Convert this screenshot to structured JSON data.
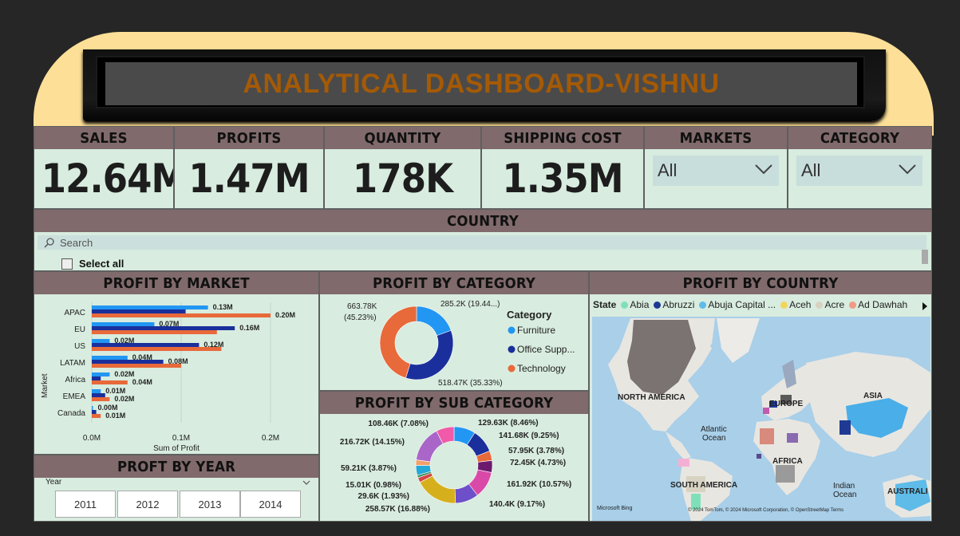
{
  "title": "ANALYTICAL DASHBOARD-VISHNU",
  "kpis": [
    {
      "label": "SALES",
      "value": "12.64M"
    },
    {
      "label": "PROFITS",
      "value": "1.47M"
    },
    {
      "label": "QUANTITY",
      "value": "178K"
    },
    {
      "label": "SHIPPING COST",
      "value": "1.35M"
    }
  ],
  "filters": {
    "markets": {
      "label": "MARKETS",
      "value": "All"
    },
    "category": {
      "label": "CATEGORY",
      "value": "All"
    }
  },
  "country_slicer": {
    "label": "COUNTRY",
    "search_placeholder": "Search",
    "select_all": "Select all"
  },
  "profit_by_market": {
    "title": "PROFIT BY MARKET",
    "ylabel": "Market",
    "xlabel": "Sum of Profit",
    "ticks": [
      "0.0M",
      "0.1M",
      "0.2M"
    ]
  },
  "profit_by_category": {
    "title": "PROFIT BY CATEGORY",
    "legend_title": "Category",
    "labels": [
      "663.78K",
      "(45.23%)",
      "285.2K (19.44...)",
      "518.47K (35.33%)"
    ]
  },
  "profit_by_sub_category": {
    "title": "PROFIT BY SUB CATEGORY"
  },
  "profit_by_year": {
    "title": "PROFT BY YEAR",
    "field": "Year",
    "years": [
      "2011",
      "2012",
      "2013",
      "2014"
    ]
  },
  "profit_by_country": {
    "title": "PROFIT BY COUNTRY",
    "legend_title": "State",
    "legend": [
      {
        "name": "Abia",
        "color": "#7fe0b8"
      },
      {
        "name": "Abruzzi",
        "color": "#1f3a93"
      },
      {
        "name": "Abuja Capital ...",
        "color": "#5fbbe8"
      },
      {
        "name": "Aceh",
        "color": "#f2d65a"
      },
      {
        "name": "Acre",
        "color": "#d8d2c2"
      },
      {
        "name": "Ad Dawhah",
        "color": "#f09a86"
      }
    ],
    "map_labels": [
      "NORTH AMERICA",
      "EUROPE",
      "ASIA",
      "Atlantic",
      "Ocean",
      "AFRICA",
      "SOUTH AMERICA",
      "Indian",
      "Ocean",
      "AUSTRALI"
    ],
    "attribution": "© 2024 TomTom, © 2024 Microsoft Corporation, © OpenStreetMap  Terms",
    "bing": "Microsoft Bing"
  },
  "chart_data": [
    {
      "type": "bar",
      "title": "PROFIT BY MARKET",
      "categories": [
        "APAC",
        "EU",
        "US",
        "LATAM",
        "Africa",
        "EMEA",
        "Canada"
      ],
      "xlabel": "Sum of Profit",
      "ylabel": "Market",
      "xlim": [
        0,
        0.24
      ],
      "series": [
        {
          "color": "#2196f3",
          "values": [
            0.13,
            0.07,
            0.02,
            0.04,
            0.02,
            0.01,
            0.0
          ],
          "labels": [
            "0.13M",
            "0.07M",
            "0.02M",
            "0.04M",
            "0.02M",
            "0.01M",
            "0.00M"
          ]
        },
        {
          "color": "#1a2f9b",
          "values": [
            0.105,
            0.16,
            0.12,
            0.08,
            0.01,
            0.015,
            0.005
          ],
          "labels": [
            "",
            "0.16M",
            "0.12M",
            "0.08M",
            "",
            "",
            ""
          ]
        },
        {
          "color": "#e8693a",
          "values": [
            0.2,
            0.14,
            0.145,
            0.1,
            0.04,
            0.02,
            0.01
          ],
          "labels": [
            "0.20M",
            "",
            "",
            "",
            "0.04M",
            "0.02M",
            "0.01M"
          ]
        }
      ]
    },
    {
      "type": "pie",
      "title": "PROFIT BY CATEGORY",
      "donut": true,
      "slices": [
        {
          "name": "Furniture",
          "value": 285.2,
          "pct": 19.44,
          "color": "#2196f3"
        },
        {
          "name": "Office Supp...",
          "value": 518.47,
          "pct": 35.33,
          "color": "#1a2f9b"
        },
        {
          "name": "Technology",
          "value": 663.78,
          "pct": 45.23,
          "color": "#e8693a"
        }
      ]
    },
    {
      "type": "pie",
      "title": "PROFIT BY SUB CATEGORY",
      "donut": true,
      "slices": [
        {
          "label": "129.63K (8.46%)",
          "value": 8.46,
          "color": "#2196f3"
        },
        {
          "label": "141.68K (9.25%)",
          "value": 9.25,
          "color": "#1a2f9b"
        },
        {
          "label": "57.95K (3.78%)",
          "value": 3.78,
          "color": "#e8693a"
        },
        {
          "label": "72.45K (4.73%)",
          "value": 4.73,
          "color": "#6b1a6e"
        },
        {
          "label": "161.92K (10.57%)",
          "value": 10.57,
          "color": "#d94aa8"
        },
        {
          "label": "140.4K (9.17%)",
          "value": 9.17,
          "color": "#6d4fc9"
        },
        {
          "label": "258.57K (16.88%)",
          "value": 16.88,
          "color": "#d6b01c"
        },
        {
          "label": "29.6K (1.93%)",
          "value": 1.93,
          "color": "#d64545"
        },
        {
          "label": "15.01K (0.98%)",
          "value": 0.98,
          "color": "#3a8f5a"
        },
        {
          "label": "59.21K (3.87%)",
          "value": 3.87,
          "color": "#23a8d8"
        },
        {
          "label": "",
          "value": 2.2,
          "color": "#f2a06a"
        },
        {
          "label": "216.72K (14.15%)",
          "value": 14.15,
          "color": "#a966c8"
        },
        {
          "label": "108.46K (7.08%)",
          "value": 7.08,
          "color": "#f05aa8"
        }
      ]
    }
  ]
}
